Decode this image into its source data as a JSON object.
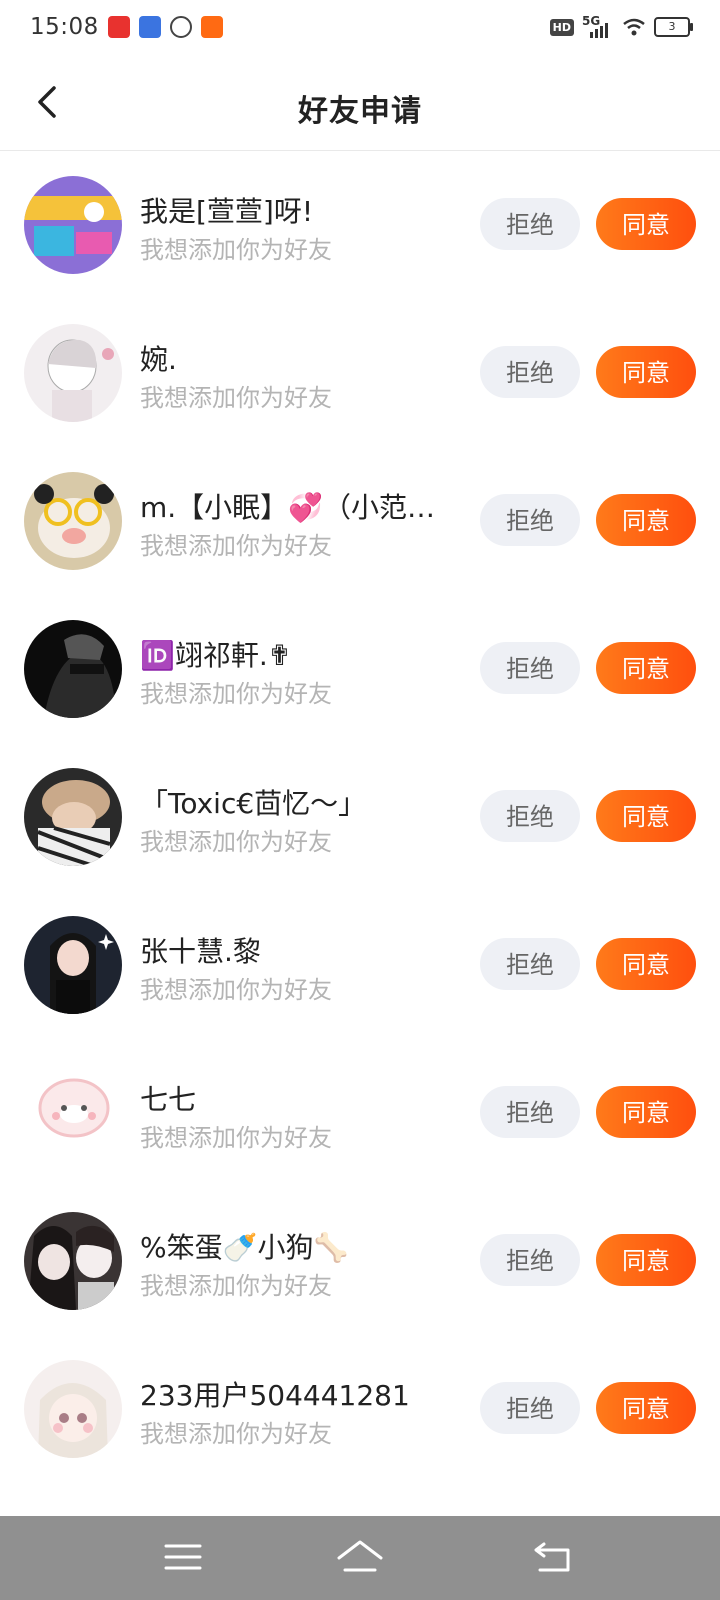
{
  "status_bar": {
    "time": "15:08",
    "hd_label": "HD",
    "network_label": "5G",
    "battery_level": "3"
  },
  "header": {
    "title": "好友申请"
  },
  "requests": [
    {
      "name": "我是[萱萱]呀!",
      "subtitle": "我想添加你为好友",
      "reject_label": "拒绝",
      "accept_label": "同意"
    },
    {
      "name": "婉.",
      "subtitle": "我想添加你为好友",
      "reject_label": "拒绝",
      "accept_label": "同意"
    },
    {
      "name": "m.【小眠】💞（小范…",
      "subtitle": "我想添加你为好友",
      "reject_label": "拒绝",
      "accept_label": "同意"
    },
    {
      "name": "🆔翊祁軒.✟",
      "subtitle": "我想添加你为好友",
      "reject_label": "拒绝",
      "accept_label": "同意"
    },
    {
      "name": "「Toxic€茴忆～」",
      "subtitle": "我想添加你为好友",
      "reject_label": "拒绝",
      "accept_label": "同意"
    },
    {
      "name": "张十慧.黎",
      "subtitle": "我想添加你为好友",
      "reject_label": "拒绝",
      "accept_label": "同意"
    },
    {
      "name": "七七",
      "subtitle": "我想添加你为好友",
      "reject_label": "拒绝",
      "accept_label": "同意"
    },
    {
      "name": "%笨蛋🍼小狗🦴",
      "subtitle": "我想添加你为好友",
      "reject_label": "拒绝",
      "accept_label": "同意"
    },
    {
      "name": "233用户504441281",
      "subtitle": "我想添加你为好友",
      "reject_label": "拒绝",
      "accept_label": "同意"
    }
  ],
  "colors": {
    "accent": "#ff5a12",
    "reject_bg": "#eef0f5",
    "subtitle": "#b4b4b4",
    "nav_bar": "#909090"
  },
  "icons": {
    "back": "chevron-left-icon",
    "nav_menu": "menu-icon",
    "nav_home": "home-icon",
    "nav_back": "back-icon"
  }
}
